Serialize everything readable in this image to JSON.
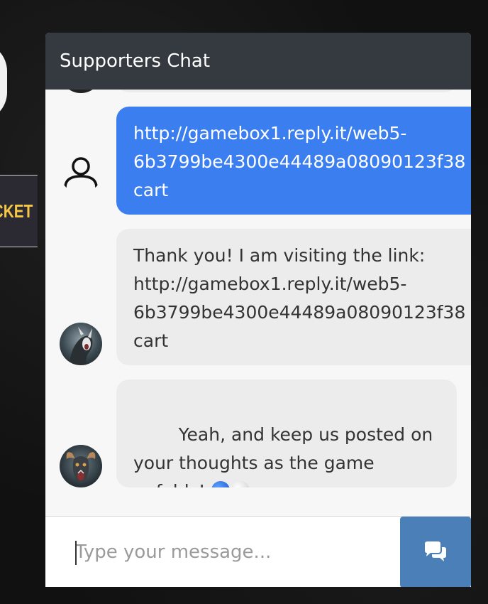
{
  "background": {
    "ticket_label": "TICKET"
  },
  "chat": {
    "title": "Supporters Chat",
    "messages": [
      {
        "direction": "outgoing",
        "text": "http://gamebox1.reply.it/web5-\n6b3799be4300e44489a08090123f38\ncart"
      },
      {
        "direction": "incoming",
        "text": "Thank you! I am visiting the link:\nhttp://gamebox1.reply.it/web5-\n6b3799be4300e44489a08090123f38\ncart"
      },
      {
        "direction": "incoming",
        "text": "Yeah, and keep us posted on\nyour thoughts as the game\nunfolds!"
      }
    ],
    "composer": {
      "placeholder": "Type your message..."
    }
  },
  "icons": {
    "user": "user-outline-icon",
    "send": "comments-icon",
    "emoji_blue": "blue-circle-emoji",
    "emoji_white": "white-circle-emoji"
  },
  "colors": {
    "header": "#343a40",
    "outgoing_bubble": "#3b7ef0",
    "incoming_bubble": "#ececec",
    "send_button": "#4a7fb8"
  }
}
